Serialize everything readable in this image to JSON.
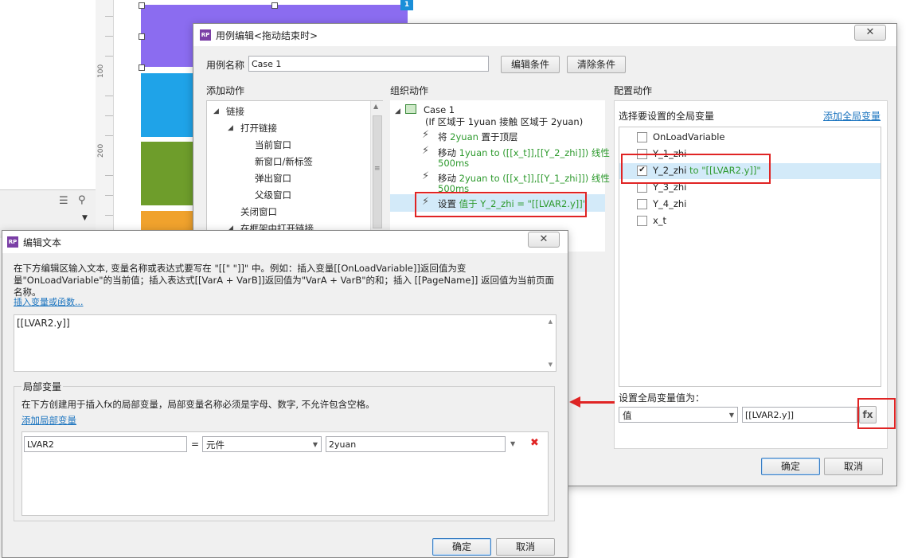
{
  "canvas": {
    "ruler_labels": [
      "100",
      "200"
    ],
    "shape_colors": [
      "#8b6cf0",
      "#1fa3e8",
      "#6e9d2b",
      "#f0a22d"
    ],
    "selection_badge": "1"
  },
  "case_editor": {
    "title": "用例编辑<拖动结束时>",
    "case_name_label": "用例名称",
    "case_name_value": "Case 1",
    "edit_condition_label": "编辑条件",
    "clear_condition_label": "清除条件",
    "add_actions_heading": "添加动作",
    "organize_actions_heading": "组织动作",
    "configure_actions_heading": "配置动作",
    "action_tree": [
      {
        "label": "链接",
        "level": 0,
        "expander": "◢"
      },
      {
        "label": "打开链接",
        "level": 1,
        "expander": "◢"
      },
      {
        "label": "当前窗口",
        "level": 2,
        "expander": ""
      },
      {
        "label": "新窗口/新标签",
        "level": 2,
        "expander": ""
      },
      {
        "label": "弹出窗口",
        "level": 2,
        "expander": ""
      },
      {
        "label": "父级窗口",
        "level": 2,
        "expander": ""
      },
      {
        "label": "关闭窗口",
        "level": 1,
        "expander": ""
      },
      {
        "label": "在框架中打开链接",
        "level": 1,
        "expander": "◢"
      }
    ],
    "case_title": "Case 1",
    "case_condition": "(If 区域于 1yuan 接触 区域于 2yuan)",
    "organize_items": [
      {
        "prefix": "将 ",
        "highlight": "2yuan",
        "suffix": " 置于顶层",
        "line2": ""
      },
      {
        "prefix": "移动 ",
        "highlight": "1yuan to ([[x_t]],[[Y_2_zhi]]) 线性",
        "suffix": "",
        "line2": "500ms"
      },
      {
        "prefix": "移动 ",
        "highlight": "2yuan to ([[x_t]],[[Y_1_zhi]]) 线性",
        "suffix": "",
        "line2": "500ms"
      },
      {
        "prefix": "设置 ",
        "highlight": "值于 Y_2_zhi = \"[[LVAR2.y]]\"",
        "suffix": "",
        "line2": ""
      }
    ],
    "select_vars_label": "选择要设置的全局变量",
    "add_global_var_link": "添加全局变量",
    "variables": [
      {
        "name": "OnLoadVariable",
        "checked": false,
        "value": ""
      },
      {
        "name": "Y_1_zhi",
        "checked": false,
        "value": ""
      },
      {
        "name": "Y_2_zhi",
        "checked": true,
        "value": " to \"[[LVAR2.y]]\""
      },
      {
        "name": "Y_3_zhi",
        "checked": false,
        "value": ""
      },
      {
        "name": "Y_4_zhi",
        "checked": false,
        "value": ""
      },
      {
        "name": "x_t",
        "checked": false,
        "value": ""
      }
    ],
    "set_value_label": "设置全局变量值为：",
    "value_type": "值",
    "value_input": "[[LVAR2.y]]",
    "fx_label": "fx",
    "ok_label": "确定",
    "cancel_label": "取消"
  },
  "text_editor": {
    "title": "编辑文本",
    "description": "在下方编辑区输入文本, 变量名称或表达式要写在 \"[[\" \"]]\" 中。例如：插入变量[[OnLoadVariable]]返回值为变量\"OnLoadVariable\"的当前值；插入表达式[[VarA + VarB]]返回值为\"VarA + VarB\"的和；插入 [[PageName]] 返回值为当前页面名称。",
    "insert_link": "插入变量或函数...",
    "editor_text": "[[LVAR2.y]]",
    "local_vars_heading": "局部变量",
    "local_vars_desc": "在下方创建用于插入fx的局部变量，局部变量名称必须是字母、数字, 不允许包含空格。",
    "add_local_var_link": "添加局部变量",
    "local_var_name": "LVAR2",
    "equals": "=",
    "local_var_type": "元件",
    "local_var_target": "2yuan",
    "delete_symbol": "✖",
    "ok_label": "确定",
    "cancel_label": "取消"
  }
}
